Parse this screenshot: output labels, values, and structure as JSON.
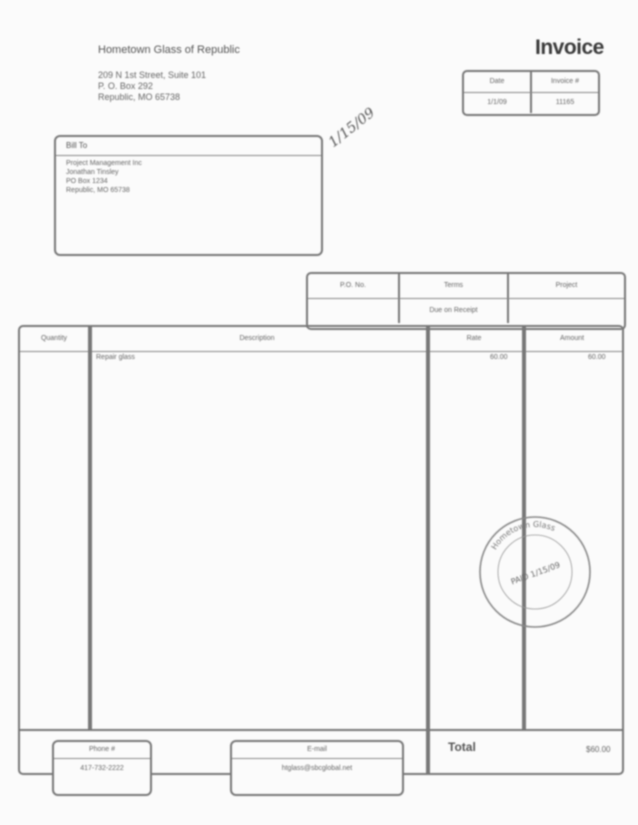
{
  "company": {
    "name": "Hometown Glass of Republic",
    "address_lines": [
      "209 N 1st Street, Suite 101",
      "P. O. Box 292",
      "Republic, MO 65738"
    ]
  },
  "title": "Invoice",
  "meta": {
    "headers": [
      "Date",
      "Invoice #"
    ],
    "values": [
      "1/1/09",
      "11165"
    ]
  },
  "bill_to": {
    "header": "Bill To",
    "lines": [
      "Project Management Inc",
      "Jonathan Tinsley",
      "PO Box 1234",
      "Republic, MO 65738"
    ]
  },
  "handwritten_note": "1/15/09",
  "terms": {
    "headers": [
      "P.O. No.",
      "Terms",
      "Project"
    ],
    "values": [
      "",
      "Due on Receipt",
      ""
    ]
  },
  "items": {
    "headers": [
      "Quantity",
      "Description",
      "Rate",
      "Amount"
    ],
    "rows": [
      {
        "quantity": "",
        "description": "Repair glass",
        "rate": "60.00",
        "amount": "60.00"
      }
    ]
  },
  "footer": {
    "phone_label": "Phone #",
    "phone_value": "417-732-2222",
    "email_label": "E-mail",
    "email_value": "htglass@sbcglobal.net",
    "total_label": "Total",
    "total_value": "$60.00"
  },
  "stamp": {
    "text": "PAID 1/15/09",
    "ring_text": "Hometown Glass"
  },
  "colors": {
    "ink": "#777777",
    "paper": "#fbfbfb"
  }
}
